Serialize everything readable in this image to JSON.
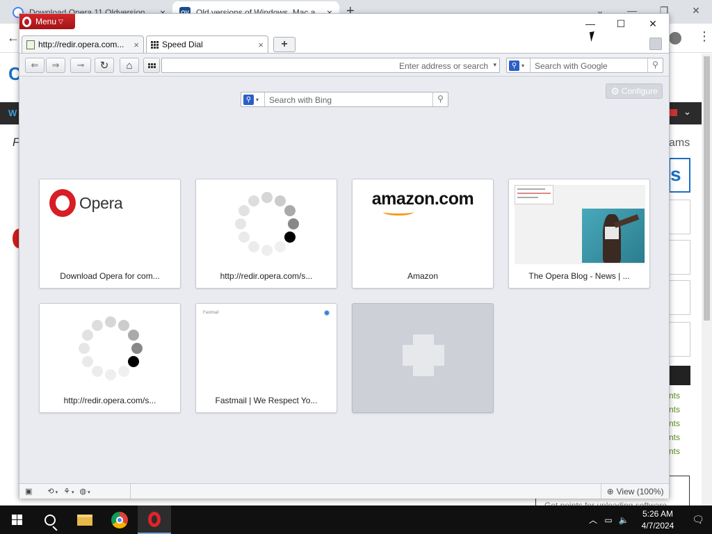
{
  "chrome": {
    "tabs": [
      {
        "title": "Download Opera 11 Oldversion",
        "close": "×"
      },
      {
        "title": "Old versions of Windows, Mac a",
        "close": "×"
      }
    ],
    "newtab": "+",
    "window_buttons": [
      "⌄",
      "—",
      "❐",
      "✕"
    ],
    "back": "←",
    "menu": "⋮"
  },
  "background_page": {
    "logo_letter": "C",
    "nav_letter": "W",
    "italic_letter": "F",
    "side_text": "ams",
    "box_letter": "s",
    "links": [
      "nts",
      "nts",
      "nts",
      "nts",
      "nts"
    ],
    "footer_text": "Get points for uploading software"
  },
  "opera": {
    "menu_label": "Menu",
    "window_controls": {
      "minimize": "—",
      "maximize": "☐",
      "close": "✕"
    },
    "tabs": [
      {
        "title": "http://redir.opera.com...",
        "close": "×"
      },
      {
        "title": "Speed Dial",
        "close": "×"
      }
    ],
    "new_tab_label": "+",
    "toolbar": {
      "back": "⇐",
      "forward": "⇒",
      "key": "⊸",
      "reload": "↻",
      "home": "⌂",
      "address_placeholder": "Enter address or search",
      "search_placeholder": "Search with Google",
      "dropdown": "▾"
    },
    "speed_dial": {
      "search_placeholder": "Search with Bing",
      "configure_label": "Configure",
      "tiles": [
        {
          "caption": "Download Opera for com...",
          "logo_word": "Opera"
        },
        {
          "caption": "http://redir.opera.com/s..."
        },
        {
          "caption": "Amazon",
          "logo_word": "amazon.com"
        },
        {
          "caption": "The Opera Blog - News | ..."
        },
        {
          "caption": "http://redir.opera.com/s..."
        },
        {
          "caption": "Fastmail | We Respect Yo...",
          "mini_text": "Fastmail"
        }
      ]
    },
    "statusbar": {
      "view_label": "View (100%)"
    },
    "colors": {
      "brand_red": "#d71e25",
      "accent_blue": "#2d5ec8"
    }
  },
  "taskbar": {
    "time": "5:26 AM",
    "date": "4/7/2024",
    "tray_chevron": "︿",
    "icons": [
      "windows-start-icon",
      "search-icon",
      "file-explorer-icon",
      "chrome-icon",
      "opera-icon"
    ]
  }
}
